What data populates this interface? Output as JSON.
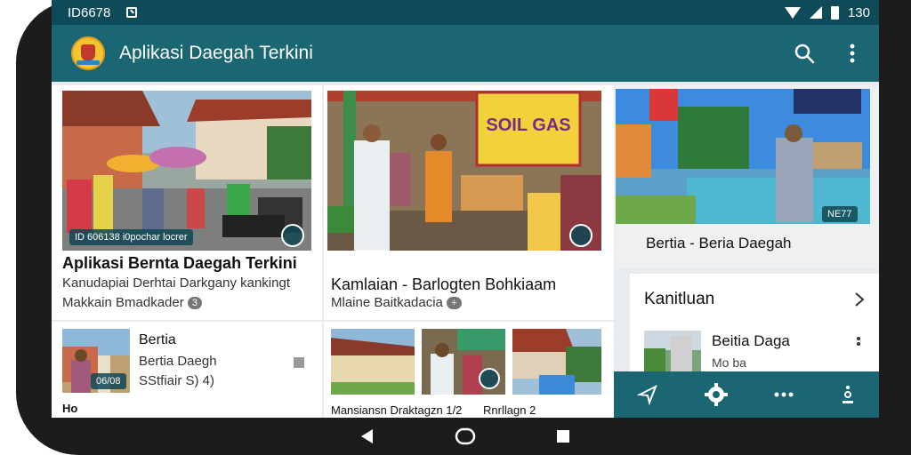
{
  "status_bar": {
    "left_text": "ID6678",
    "right_text": "130"
  },
  "app_bar": {
    "title": "Aplikasi Daegah Terkini"
  },
  "hero_cards": [
    {
      "badge": "ID 606138 i0pochar locrer",
      "title": "Aplikasi Bernta Daegah Terkini",
      "subtitle1": "Kanudapiai Derhtai Darkgany kankingt",
      "subtitle2": "Makkain Bmadkader",
      "count": "3"
    },
    {
      "banner_text": "SOIL GAS",
      "title": "Kamlaian - Barlogten Bohkiaam",
      "subtitle": "Mlaine Baitkadacia",
      "count": "+"
    }
  ],
  "side_card": {
    "badge": "NE77",
    "caption": "Bertia - Beria Daegah"
  },
  "side_section": {
    "title": "Kanitluan",
    "item_title": "Beitia Daga",
    "item_sub": "Mo ba"
  },
  "list_item": {
    "badge": "06/08",
    "title": "Bertia",
    "line1": "Bertia Daegh",
    "line2": "SStfiair S) 4)"
  },
  "footer_fragments": {
    "left": "Ho",
    "middle": "Mansiansn Draktagzn 1/2",
    "right": "Rnrllagn 2"
  }
}
